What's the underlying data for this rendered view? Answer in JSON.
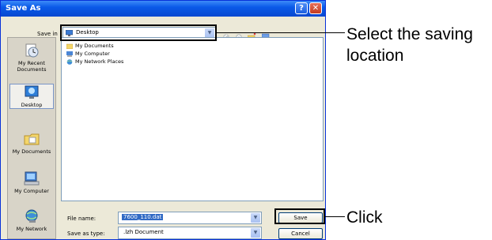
{
  "window": {
    "title": "Save As"
  },
  "titlebar_buttons": {
    "help": "?",
    "close": "✕"
  },
  "save_in": {
    "label": "Save in",
    "value": "Desktop"
  },
  "toolbar_icons": [
    "back-icon",
    "up-folder-icon",
    "new-folder-icon",
    "view-menu-icon"
  ],
  "places_bar": [
    {
      "label": "My Recent Documents",
      "icon": "recent-documents-icon"
    },
    {
      "label": "Desktop",
      "icon": "desktop-icon"
    },
    {
      "label": "My Documents",
      "icon": "my-documents-icon"
    },
    {
      "label": "My Computer",
      "icon": "my-computer-icon"
    },
    {
      "label": "My Network",
      "icon": "my-network-icon"
    }
  ],
  "files": [
    {
      "name": "My Documents",
      "icon": "folder-icon"
    },
    {
      "name": "My Computer",
      "icon": "computer-icon"
    },
    {
      "name": "My Network Places",
      "icon": "network-icon"
    }
  ],
  "file_name": {
    "label": "File name:",
    "value": "7600_110.dat"
  },
  "save_as_type": {
    "label": "Save as type:",
    "value": ".lzh Document"
  },
  "buttons": {
    "save": "Save",
    "cancel": "Cancel"
  },
  "annotations": {
    "select_location": [
      "Select the saving",
      "location"
    ],
    "click": "Click"
  },
  "colors": {
    "titlebar": "#0a5ae8",
    "dialog_bg": "#ece9d8",
    "selection": "#316ac5"
  }
}
